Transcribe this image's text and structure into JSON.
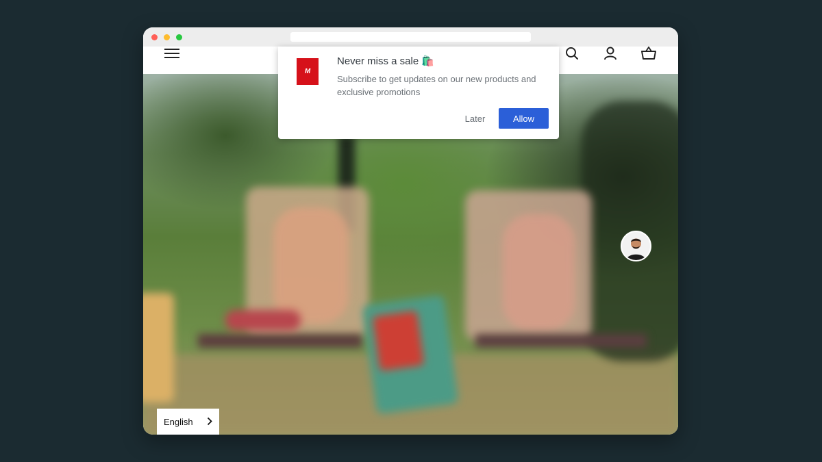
{
  "popup": {
    "logo_text": "M",
    "title": "Never miss a sale 🛍️",
    "message": "Subscribe to get updates on our new products and exclusive promotions",
    "later_label": "Later",
    "allow_label": "Allow"
  },
  "language": {
    "current": "English"
  },
  "colors": {
    "allow_button": "#2b5fd8",
    "brand_red": "#d6111a",
    "page_background": "#1b2b31"
  },
  "icons": [
    "menu-icon",
    "search-icon",
    "account-icon",
    "cart-icon",
    "chevron-right-icon"
  ]
}
